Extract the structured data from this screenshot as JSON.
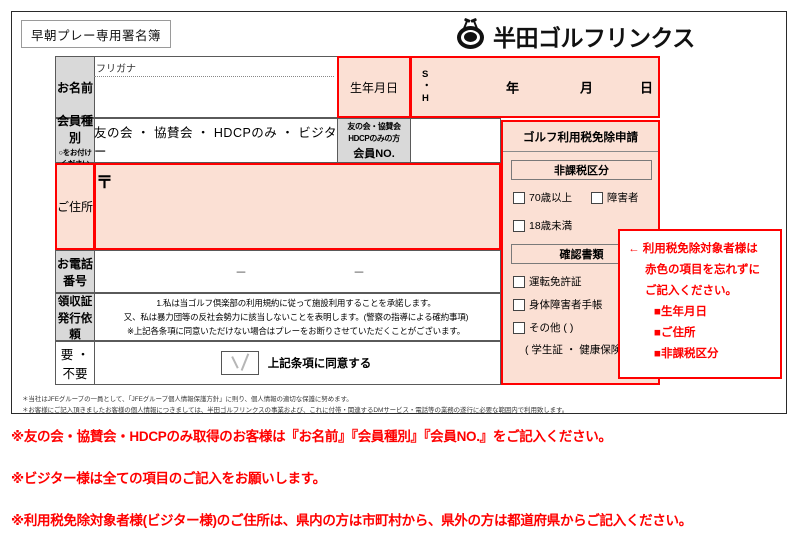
{
  "title_chip": "早朝プレー専用署名簿",
  "brand": {
    "name": "半田ゴルフリンクス",
    "logo_icon": "golf-emblem-icon",
    "accent_red": "#ff0000",
    "pink_fill": "#fbe0d4",
    "gray_fill": "#d9d9d9"
  },
  "form": {
    "name_row": {
      "label": "お名前",
      "furigana_label": "フリガナ",
      "name_value": "",
      "birth_label": "生年月日",
      "era_line1": "S",
      "era_line2": "・",
      "era_line3": "H",
      "year": "年",
      "month": "月",
      "day": "日"
    },
    "member_row": {
      "label": "会員種別",
      "sub_label": "○をお付けください",
      "choices": "友の会 ・ 協賛会 ・ HDCPのみ ・ ビジター",
      "memberno_line1": "友の会・協賛会",
      "memberno_line2": "HDCPのみの方",
      "memberno_line3": "会員NO.",
      "memberno_value": ""
    },
    "address_row": {
      "label": "ご住所",
      "postal_mark": "〒",
      "value": ""
    },
    "phone_row": {
      "label": "お電話番号",
      "dash1": "－",
      "dash2": "－",
      "value": ""
    },
    "receipt_row": {
      "label_line1": "領収証",
      "label_line2": "発行依頼",
      "terms": [
        "1.私は当ゴルフ倶楽部の利用規約に従って施設利用することを承諾します。",
        "又、私は暴力団等の反社会勢力に該当しないことを表明します。(警察の指導による確約事項)",
        "※上記各条項に同意いただけない場合はプレーをお断りさせていただくことがございます。"
      ]
    },
    "agree_row": {
      "label": "要 ・ 不要",
      "checkbox_icon": "checkmark-icon",
      "agree_text": "上記条項に同意する"
    }
  },
  "tax_panel": {
    "title": "ゴルフ利用税免除申請",
    "section1_title": "非課税区分",
    "section1_options": [
      "70歳以上",
      "障害者",
      "18歳未満"
    ],
    "section2_title": "確認書類",
    "section2_options": [
      "運転免許証",
      "身体障害者手帳",
      "その他 (                  )"
    ],
    "section2_hint": "( 学生証 ・ 健康保険証 )"
  },
  "callout": {
    "arrow_icon": "left-arrow-icon",
    "lines": [
      "← 利用税免除対象者様は",
      "赤色の項目を忘れずに",
      "ご記入ください。",
      "■生年月日",
      "■ご住所",
      "■非課税区分"
    ]
  },
  "footnotes": [
    "＊当社はJFEグループの一員として、「JFEグループ個人情報保護方針」に則り、個人情報の適切な保護に努めます。",
    "＊お客様にご記入頂きましたお客様の個人情報につきましては、半田ゴルフリンクスの事業および、これに付帯・関連するDMサービス・電話等の業務の遂行に必要な範囲内で利用致します。"
  ],
  "notes": [
    "※友の会・協賛会・HDCPのみ取得のお客様は『お名前』『会員種別』『会員NO.』をご記入ください。",
    "※ビジター様は全ての項目のご記入をお願いします。",
    "※利用税免除対象者様(ビジター様)のご住所は、県内の方は市町村から、県外の方は都道府県からご記入ください。"
  ]
}
